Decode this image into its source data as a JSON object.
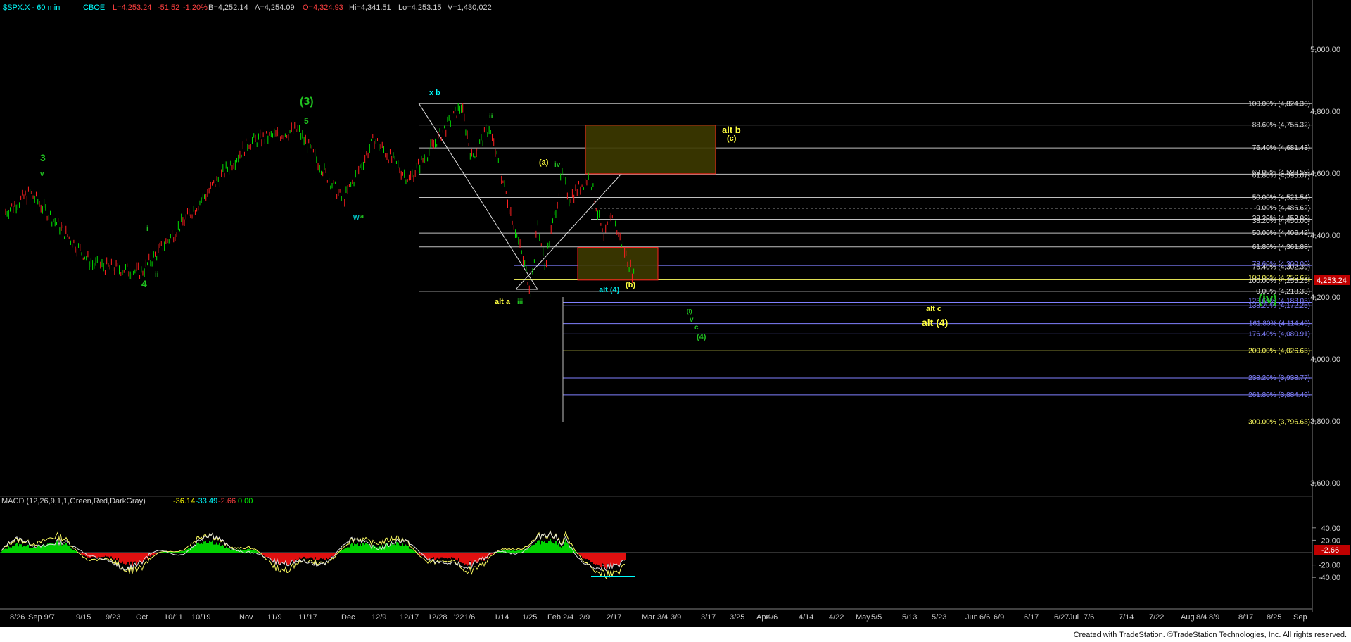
{
  "header": {
    "symbol": "$SPX.X - 60 min",
    "exchange": "CBOE",
    "last": "L=4,253.24",
    "change": "-51.52",
    "change_pct": "-1.20%",
    "bid": "B=4,252.14",
    "ask": "A=4,254.09",
    "open": "O=4,324.93",
    "high": "Hi=4,341.51",
    "low": "Lo=4,253.15",
    "volume": "V=1,430,022"
  },
  "macd_header": {
    "label": "MACD (12,26,9,1,1,Green,Red,DarkGray)",
    "v1": "-36.14",
    "v2": "-33.49",
    "v3": "-2.66",
    "v4": "0.00"
  },
  "price_axis": [
    "5,000.00",
    "4,800.00",
    "4,600.00",
    "4,400.00",
    "4,200.00",
    "4,000.00",
    "3,800.00",
    "3,600.00"
  ],
  "macd_axis": [
    "40.00",
    "20.00",
    "-20.00",
    "-40.00"
  ],
  "macd_current_tag": "-2.66",
  "price_tag": "4,253.24",
  "date_axis": [
    "8/26",
    "Sep 9/7",
    "9/15",
    "9/23",
    "Oct",
    "10/11",
    "10/19",
    "Nov",
    "11/9",
    "11/17",
    "Dec",
    "12/9",
    "12/17",
    "12/28",
    "'22",
    "1/6",
    "1/14",
    "1/25",
    "Feb",
    "2/4",
    "2/9",
    "2/17",
    "Mar",
    "3/4",
    "3/9",
    "3/17",
    "3/25",
    "Apr",
    "4/6",
    "4/14",
    "4/22",
    "May",
    "5/5",
    "5/13",
    "5/23",
    "Jun",
    "6/6",
    "6/9",
    "6/17",
    "6/27",
    "Jul",
    "7/6",
    "7/14",
    "7/22",
    "Aug",
    "8/4",
    "8/9",
    "8/17",
    "8/25",
    "Sep"
  ],
  "fib_labels": [
    "100.00% (4,824.36)",
    "88.60% (4,755.32)",
    "76.40% (4,681.43)",
    "61.80% (4,595.07)",
    "69.00% (4,598.59)",
    "50.00% (4,521.54)",
    "0.00% (4,486.62)",
    "38.20% (4,452.09)",
    "38.20% (4,450.00)",
    "50.00% (4,406.42)",
    "61.80% (4,361.88)",
    "78.60% (4,300.00)",
    "76.40% (4,302.39)",
    "100.00% (4,256.62)",
    "100.00% (4,255.25)",
    "0.00% (4,218.33)",
    "123.60% (4,183.03)",
    "138.20% (4,172.25)",
    "161.80% (4,114.49)",
    "176.40% (4,080.91)",
    "200.00% (4,026.63)",
    "238.20% (3,938.77)",
    "261.80% (3,884.49)",
    "300.00% (3,796.63)"
  ],
  "wave_labels": {
    "w3": "3",
    "w3v": "v",
    "w4": "4",
    "wi": "i",
    "wii": "ii",
    "w5": "5",
    "w3p": "(3)",
    "wxb": "x b",
    "wii2": "ii",
    "wa": "(a)",
    "wiv": "iv",
    "walta": "alt a",
    "wiii": "iii",
    "walt4": "alt (4)",
    "wb": "(b)",
    "waltb": "alt b",
    "wc": "(c)",
    "wwa": "w",
    "wa2": "a",
    "w0": "(i)",
    "wv": "v",
    "wc2": "c",
    "w4p": "(4)",
    "waltc": "alt c",
    "walt4b": "alt (4)",
    "wivbig": "(iv)"
  },
  "chart_data": {
    "type": "candlestick",
    "title": "$SPX.X - 60 min",
    "ylabel": "",
    "ylim": [
      3520,
      5160
    ],
    "x_range": [
      "2021-08-26",
      "2022-09-01"
    ],
    "last_bar": "2022-02-23",
    "key_price_path": [
      {
        "x": "2021-08-26",
        "y": 4475
      },
      {
        "x": "2021-09-02",
        "y": 4537
      },
      {
        "x": "2021-09-20",
        "y": 4305
      },
      {
        "x": "2021-10-04",
        "y": 4280
      },
      {
        "x": "2021-11-04",
        "y": 4700
      },
      {
        "x": "2021-11-18",
        "y": 4740
      },
      {
        "x": "2021-12-01",
        "y": 4510
      },
      {
        "x": "2021-12-10",
        "y": 4710
      },
      {
        "x": "2021-12-20",
        "y": 4580
      },
      {
        "x": "2022-01-04",
        "y": 4818
      },
      {
        "x": "2022-01-07",
        "y": 4650
      },
      {
        "x": "2022-01-12",
        "y": 4748
      },
      {
        "x": "2022-01-24",
        "y": 4222
      },
      {
        "x": "2022-01-26",
        "y": 4440
      },
      {
        "x": "2022-01-28",
        "y": 4300
      },
      {
        "x": "2022-02-02",
        "y": 4595
      },
      {
        "x": "2022-02-04",
        "y": 4520
      },
      {
        "x": "2022-02-10",
        "y": 4590
      },
      {
        "x": "2022-02-14",
        "y": 4380
      },
      {
        "x": "2022-02-16",
        "y": 4470
      },
      {
        "x": "2022-02-23",
        "y": 4253
      }
    ],
    "macd": {
      "ylim": [
        -50,
        50
      ],
      "values": [
        -36.14,
        -33.49,
        -2.66,
        0.0
      ]
    }
  }
}
